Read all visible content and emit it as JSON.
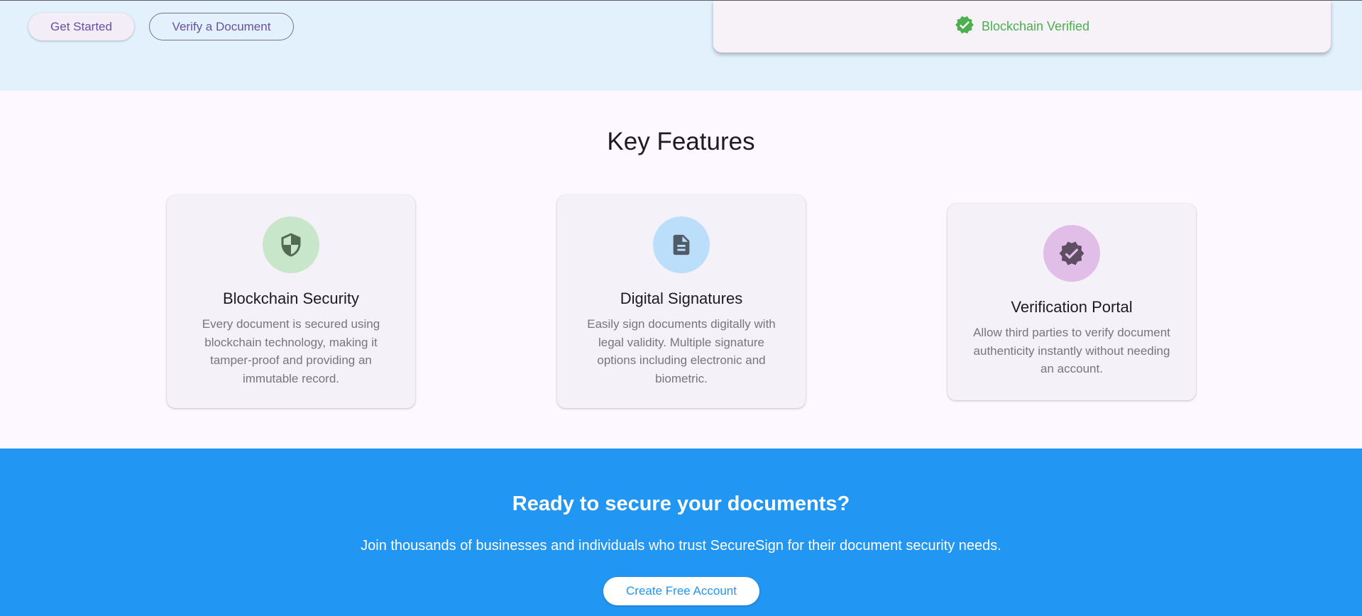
{
  "hero": {
    "get_started_label": "Get Started",
    "verify_label": "Verify a Document",
    "verified_status": "Blockchain Verified",
    "verified_icon": "verified-badge-icon"
  },
  "features": {
    "title": "Key Features",
    "items": [
      {
        "title": "Blockchain Security",
        "description": "Every document is secured using blockchain technology, making it tamper-proof and providing an immutable record.",
        "icon": "shield-icon",
        "icon_bg": "#c8e6c9",
        "icon_color": "#546a55"
      },
      {
        "title": "Digital Signatures",
        "description": "Easily sign documents digitally with legal validity. Multiple signature options including electronic and biometric.",
        "icon": "document-icon",
        "icon_bg": "#bbdefb",
        "icon_color": "#4f5b66"
      },
      {
        "title": "Verification Portal",
        "description": "Allow third parties to verify document authenticity instantly without needing an account.",
        "icon": "verified-icon",
        "icon_bg": "#e1bee7",
        "icon_color": "#5f4d63"
      }
    ]
  },
  "cta": {
    "title": "Ready to secure your documents?",
    "subtitle": "Join thousands of businesses and individuals who trust SecureSign for their document security needs.",
    "button_label": "Create Free Account"
  },
  "colors": {
    "hero_bg": "#e3f1fd",
    "page_bg": "#fdf7ff",
    "primary": "#6750a4",
    "cta_bg": "#2196f3",
    "verified_green": "#4caf50"
  }
}
